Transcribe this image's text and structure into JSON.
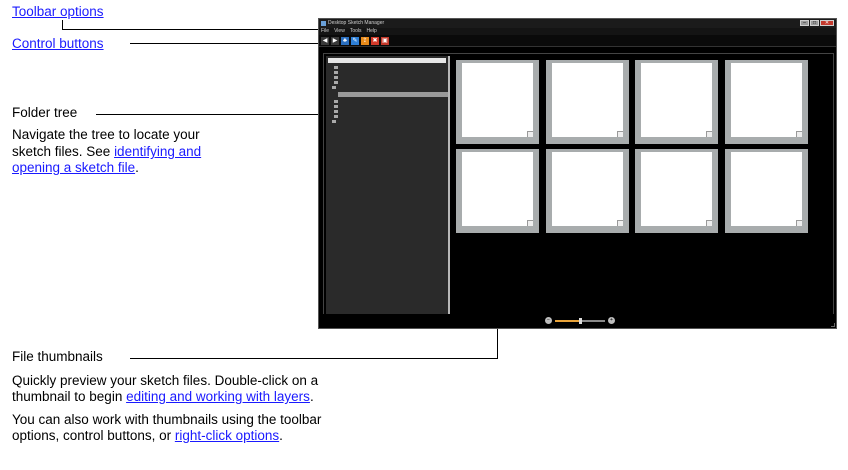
{
  "annotations": {
    "toolbar_options": "Toolbar options",
    "control_buttons": "Control buttons",
    "folder_tree_title": "Folder tree",
    "folder_tree_desc_1": "Navigate the tree to locate your",
    "folder_tree_desc_2": "sketch files.  See ",
    "folder_tree_link_1": "identifying and",
    "folder_tree_link_2": "opening a sketch file",
    "folder_tree_end": ".",
    "file_thumbnails_title": "File thumbnails",
    "thumb_desc_1": "Quickly preview your sketch files.  Double-click on a",
    "thumb_desc_2": "thumbnail to begin ",
    "thumb_link": "editing and working with layers",
    "thumb_end": ".",
    "extra_desc_1": "You can also work with thumbnails using the toolbar",
    "extra_desc_2": "options, control buttons, or ",
    "extra_link": "right-click options",
    "extra_end": "."
  },
  "window": {
    "title": "Desktop Sketch Manager",
    "menu": [
      "File",
      "View",
      "Tools",
      "Help"
    ],
    "controls": [
      "–",
      "□",
      "✕"
    ],
    "toolbar": [
      {
        "icon": "back-icon",
        "glyph": "◀",
        "color": "#3a3a3a"
      },
      {
        "icon": "forward-icon",
        "glyph": "▶",
        "color": "#3a3a3a"
      },
      {
        "icon": "tree-icon",
        "glyph": "♣",
        "color": "#2b6fbf"
      },
      {
        "icon": "edit-icon",
        "glyph": "✎",
        "color": "#2e7fd6"
      },
      {
        "icon": "export-icon",
        "glyph": "⇪",
        "color": "#e88a1a"
      },
      {
        "icon": "delete-icon",
        "glyph": "✖",
        "color": "#d23a2a"
      },
      {
        "icon": "print-icon",
        "glyph": "▣",
        "color": "#c2382a"
      }
    ],
    "thumbnail_count": 8,
    "zoom_level": 0.5
  }
}
